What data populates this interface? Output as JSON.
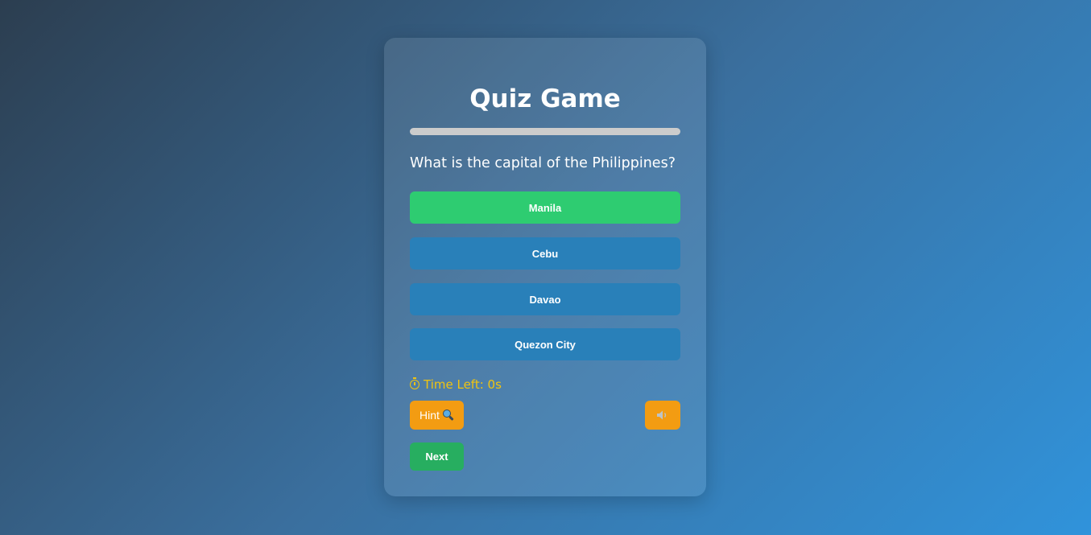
{
  "quiz": {
    "title": "Quiz Game",
    "progress_fraction": 0,
    "question": "What is the capital of the Philippines?",
    "answers": [
      {
        "label": "Manila",
        "state": "correct"
      },
      {
        "label": "Cebu",
        "state": "normal"
      },
      {
        "label": "Davao",
        "state": "normal"
      },
      {
        "label": "Quezon City",
        "state": "normal"
      }
    ],
    "timer": {
      "icon": "stopwatch-icon",
      "label": "Time Left: 0s"
    },
    "hint": {
      "label": "Hint",
      "icon": "magnifier-icon"
    },
    "sound": {
      "icon": "speaker-icon"
    },
    "next": {
      "label": "Next"
    }
  },
  "colors": {
    "correct": "#2ecc71",
    "answer": "#2980b9",
    "warning": "#f39c12",
    "timer": "#f1c40f",
    "next": "#27ae60"
  }
}
